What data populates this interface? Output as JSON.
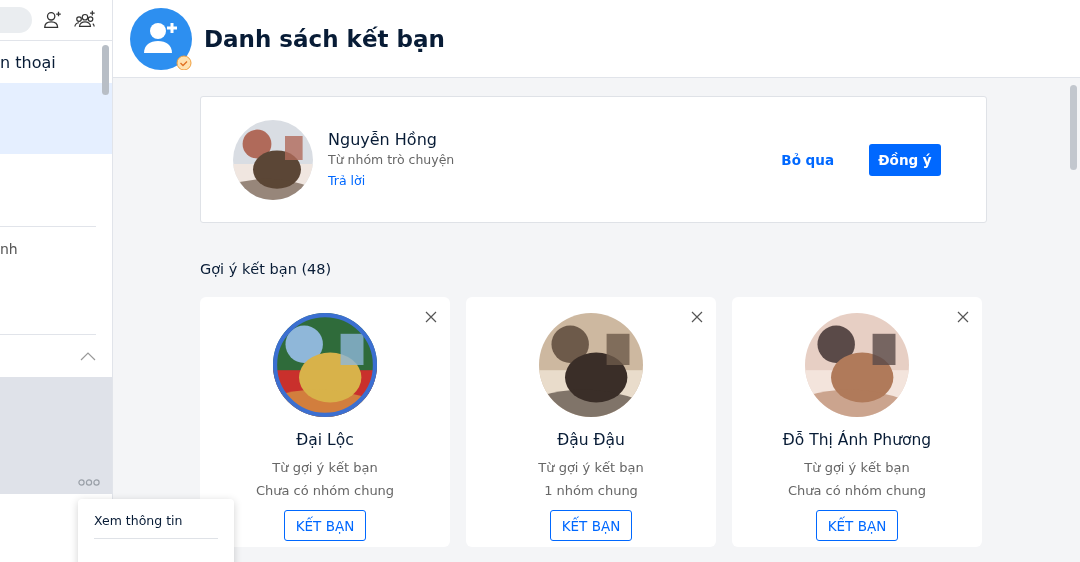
{
  "sidebar": {
    "items": [
      {
        "label": "n thoại",
        "selected": false
      },
      {
        "selected": true
      },
      {
        "label": "nh",
        "selected": false
      }
    ],
    "section": {
      "expanded": true
    }
  },
  "context_menu": {
    "items": [
      "Xem thông tin"
    ]
  },
  "header": {
    "title": "Danh sách kết bạn"
  },
  "request": {
    "name": "Nguyễn Hồng",
    "source": "Từ nhóm trò chuyện",
    "reply": "Trả lời",
    "skip": "Bỏ qua",
    "accept": "Đồng ý"
  },
  "suggestions": {
    "title": "Gợi ý kết bạn (48)",
    "cards": [
      {
        "name": "Đại Lộc",
        "source": "Từ gợi ý kết bạn",
        "mutual": "Chưa có nhóm chung",
        "action": "KẾT BẠN"
      },
      {
        "name": "Đậu Đậu",
        "source": "Từ gợi ý kết bạn",
        "mutual": "1 nhóm chung",
        "action": "KẾT BẠN"
      },
      {
        "name": "Đỗ Thị Ánh Phương",
        "source": "Từ gợi ý kết bạn",
        "mutual": "Chưa có nhóm chung",
        "action": "KẾT BẠN"
      }
    ]
  }
}
